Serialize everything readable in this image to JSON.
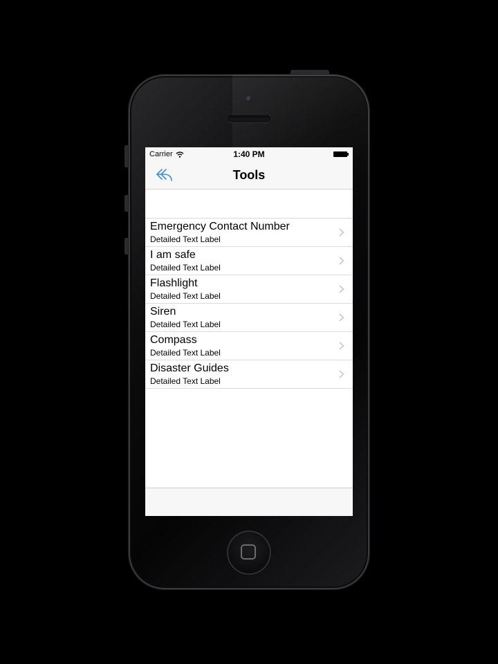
{
  "status_bar": {
    "carrier": "Carrier",
    "time": "1:40 PM",
    "icons": [
      "wifi-icon",
      "battery-icon"
    ]
  },
  "nav_bar": {
    "title": "Tools",
    "back_icon": "reply-arrow-icon"
  },
  "table": {
    "rows": [
      {
        "title": "Emergency Contact Number",
        "subtitle": "Detailed Text Label"
      },
      {
        "title": "I am safe",
        "subtitle": "Detailed Text Label"
      },
      {
        "title": "Flashlight",
        "subtitle": "Detailed Text Label"
      },
      {
        "title": "Siren",
        "subtitle": "Detailed Text Label"
      },
      {
        "title": "Compass",
        "subtitle": "Detailed Text Label"
      },
      {
        "title": "Disaster Guides",
        "subtitle": "Detailed Text Label"
      }
    ],
    "accessory_icon": "chevron-right-icon"
  },
  "colors": {
    "tint": "#3a8fd9",
    "bar_background": "#f7f7f7",
    "separator": "#dcdcde",
    "chevron": "#c7c7cc"
  }
}
